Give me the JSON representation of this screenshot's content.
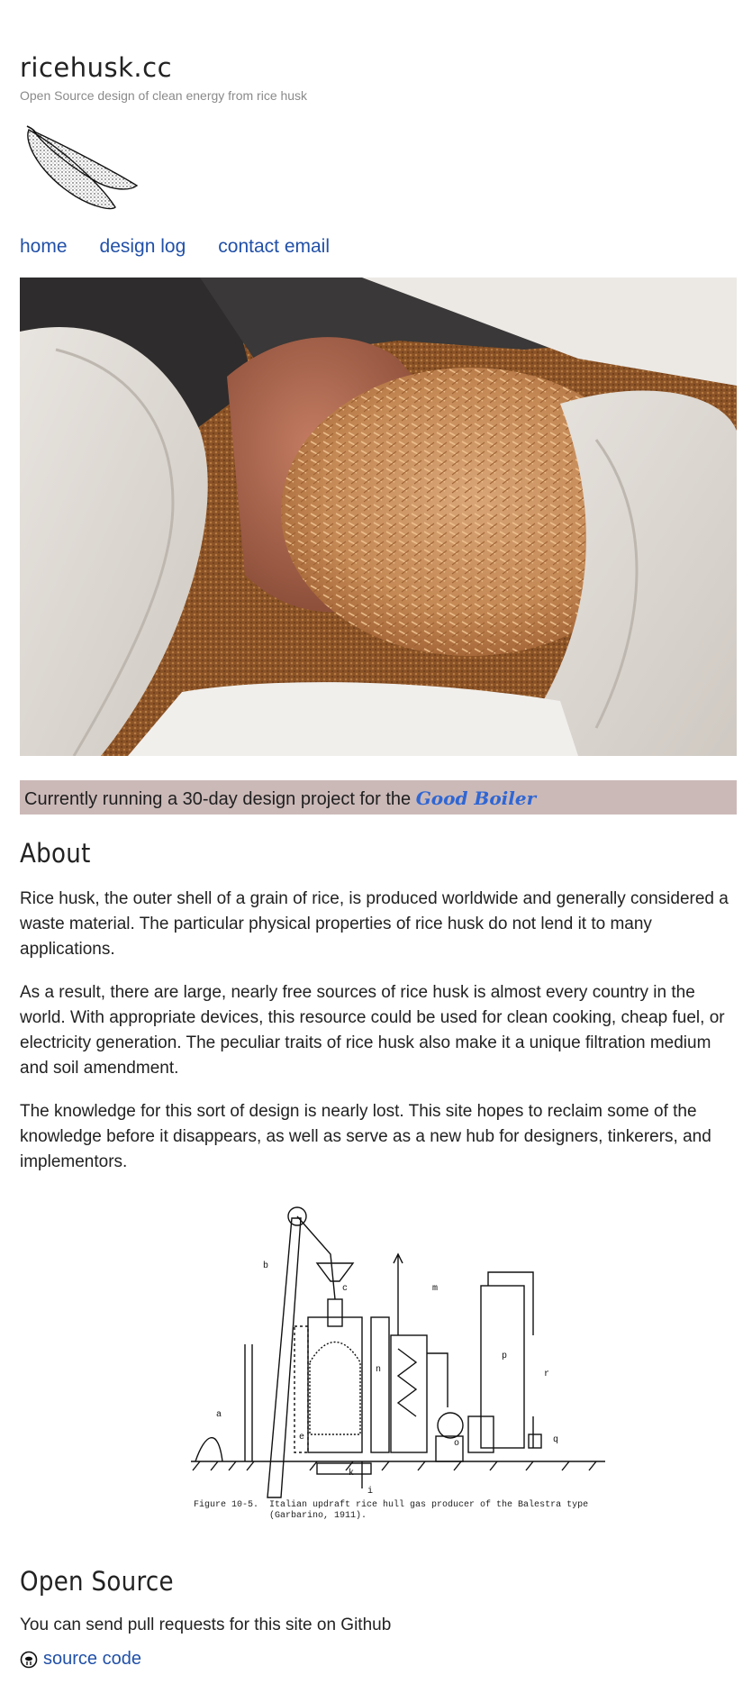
{
  "header": {
    "site_title": "ricehusk.cc",
    "tagline": "Open Source design of clean energy from rice husk",
    "logo_icon": "rice-grain-logo-icon"
  },
  "nav": {
    "items": [
      {
        "label": "home"
      },
      {
        "label": "design log"
      },
      {
        "label": "contact email"
      }
    ]
  },
  "hero": {
    "image": "hand holding rice husk in a white sack"
  },
  "banner": {
    "text": "Currently running a 30-day design project for the",
    "link": "Good Boiler"
  },
  "about": {
    "heading": "About",
    "paragraphs": [
      "Rice husk, the outer shell of a grain of rice, is produced worldwide and generally considered a waste material. The particular physical properties of rice husk do not lend it to many applications.",
      "As a result, there are large, nearly free sources of rice husk is almost every country in the world. With appropriate devices, this resource could be used for clean cooking, cheap fuel, or electricity generation. The peculiar traits of rice husk also make it a unique filtration medium and soil amendment.",
      "The knowledge for this sort of design is nearly lost. This site hopes to reclaim some of the knowledge before it disappears, as well as serve as a new hub for designers, tinkerers, and implementors."
    ]
  },
  "figure": {
    "caption": "Figure 10-5.  Italian updraft rice hull gas producer of the Balestra type\n              (Garbarino, 1911)."
  },
  "open_source": {
    "heading": "Open Source",
    "text": "You can send pull requests for this site on Github",
    "link_icon": "github-icon",
    "link_label": "source code"
  },
  "colors": {
    "link": "#2150a8",
    "banner_bg": "#cbb9b8",
    "banner_link": "#2f66d3"
  }
}
